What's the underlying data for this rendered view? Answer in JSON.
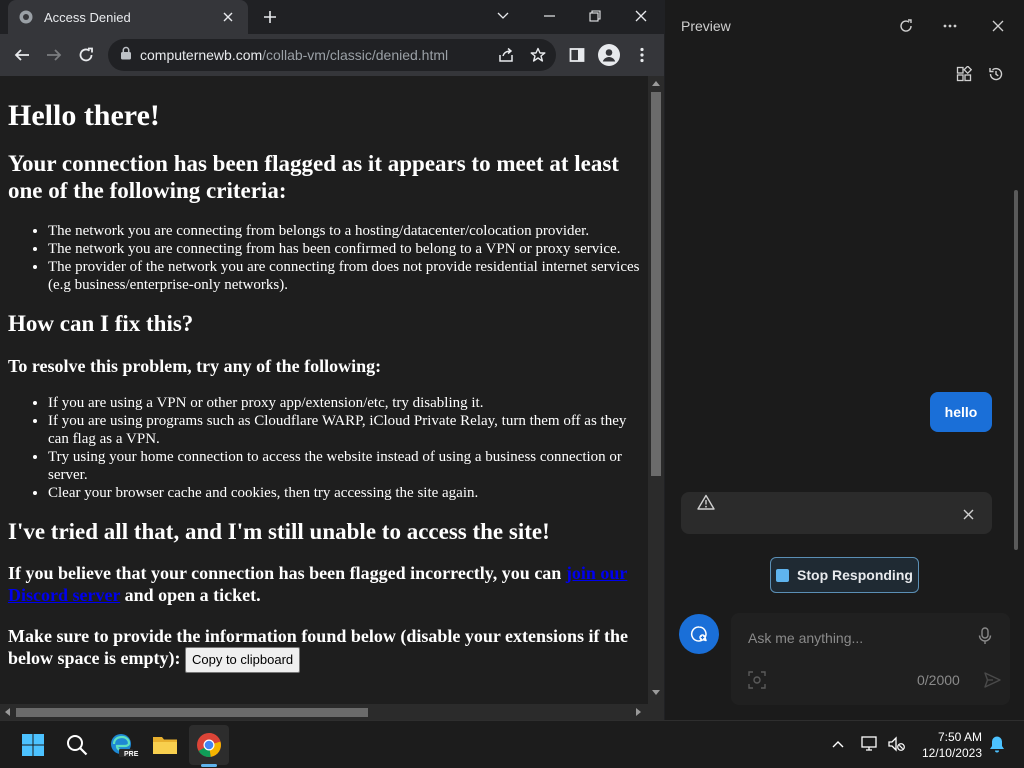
{
  "browser": {
    "tab_title": "Access Denied",
    "url_host": "computernewb.com",
    "url_path": "/collab-vm/classic/denied.html"
  },
  "page": {
    "h1": "Hello there!",
    "h2_flagged": "Your connection has been flagged as it appears to meet at least one of the following criteria:",
    "criteria": [
      "The network you are connecting from belongs to a hosting/datacenter/colocation provider.",
      "The network you are connecting from has been confirmed to belong to a VPN or proxy service.",
      "The provider of the network you are connecting from does not provide residential internet services (e.g business/enterprise-only networks)."
    ],
    "h2_fix": "How can I fix this?",
    "h3_resolve": "To resolve this problem, try any of the following:",
    "fixes": [
      "If you are using a VPN or other proxy app/extension/etc, try disabling it.",
      "If you are using programs such as Cloudflare WARP, iCloud Private Relay, turn them off as they can flag as a VPN.",
      "Try using your home connection to access the website instead of using a business connection or server.",
      "Clear your browser cache and cookies, then try accessing the site again."
    ],
    "h2_tried": "I've tried all that, and I'm still unable to access the site!",
    "believe_pre": "If you believe that your connection has been flagged incorrectly, you can ",
    "believe_link": "join our Discord server",
    "believe_post": " and open a ticket.",
    "provide_text": "Make sure to provide the information found below (disable your extensions if the below space is empty):",
    "copy_button": "Copy to clipboard"
  },
  "panel": {
    "title": "Preview",
    "user_message": "hello",
    "stop_button": "Stop Responding",
    "input_placeholder": "Ask me anything...",
    "char_count": "0/2000"
  },
  "taskbar": {
    "time": "7:50 AM",
    "date": "12/10/2023",
    "edge_badge": "PRE"
  },
  "colors": {
    "accent": "#1a6fd8",
    "link": "#0000ee"
  }
}
